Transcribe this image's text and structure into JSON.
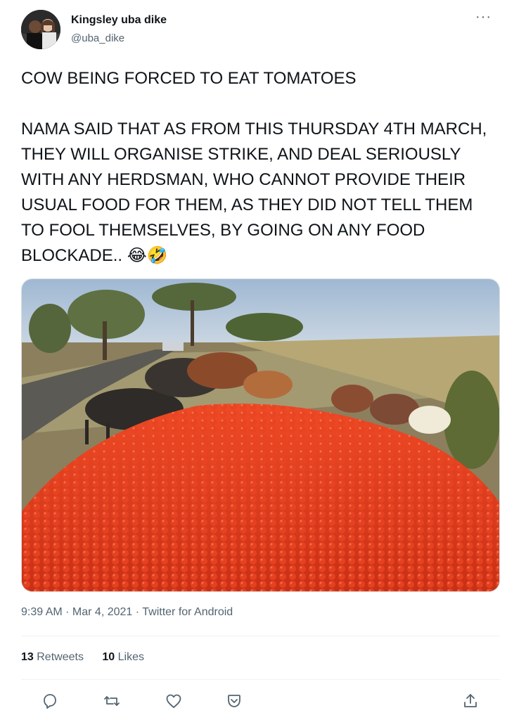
{
  "author": {
    "name": "Kingsley uba dike",
    "handle": "@uba_dike"
  },
  "tweet": {
    "text": "COW BEING FORCED TO EAT TOMATOES\n\nNAMA SAID THAT AS FROM THIS THURSDAY 4TH MARCH, THEY WILL ORGANISE STRIKE, AND DEAL SERIOUSLY WITH ANY HERDSMAN, WHO CANNOT PROVIDE THEIR USUAL FOOD FOR THEM, AS THEY DID NOT TELL THEM TO FOOL THEMSELVES, BY GOING ON ANY FOOD BLOCKADE.. 😂🤣"
  },
  "meta": {
    "time": "9:39 AM",
    "sep1": " · ",
    "date": "Mar 4, 2021",
    "sep2": " · ",
    "source": "Twitter for Android"
  },
  "stats": {
    "retweets_count": "13",
    "retweets_label": "Retweets",
    "likes_count": "10",
    "likes_label": "Likes"
  },
  "icons": {
    "more": "more-icon",
    "reply": "reply-icon",
    "retweet": "retweet-icon",
    "like": "heart-icon",
    "bookmark": "bookmark-icon",
    "share": "share-icon"
  },
  "colors": {
    "text": "#0f1419",
    "secondary": "#536471",
    "tomato": "#d9381e"
  }
}
